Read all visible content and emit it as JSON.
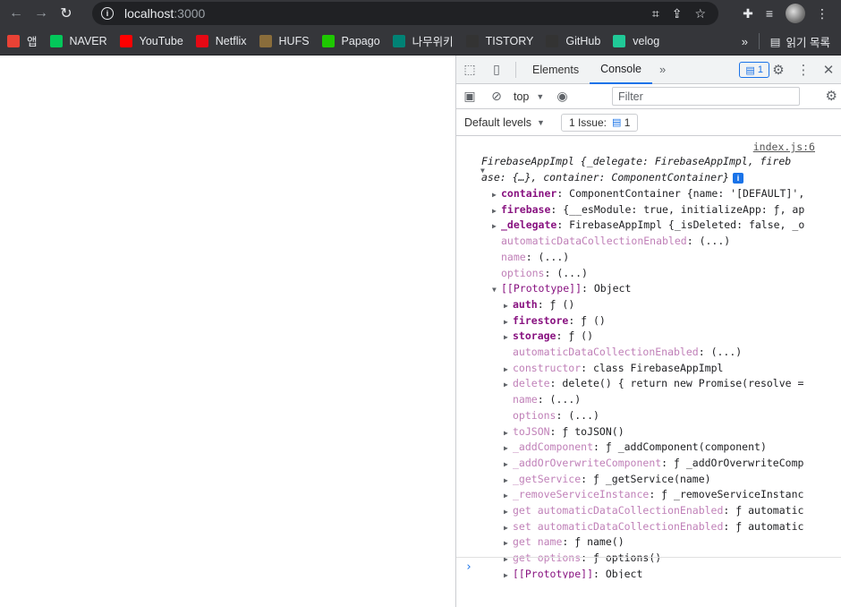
{
  "browser": {
    "url_host": "localhost",
    "url_port": ":3000"
  },
  "bookmarks": [
    {
      "label": "앱",
      "color": "#e94235"
    },
    {
      "label": "NAVER",
      "color": "#03c75a"
    },
    {
      "label": "YouTube",
      "color": "#ff0000"
    },
    {
      "label": "Netflix",
      "color": "#e50914"
    },
    {
      "label": "HUFS",
      "color": "#8a6d3b"
    },
    {
      "label": "Papago",
      "color": "#1ec800"
    },
    {
      "label": "나무위키",
      "color": "#008275"
    },
    {
      "label": "TISTORY",
      "color": "#333333"
    },
    {
      "label": "GitHub",
      "color": "#333333"
    },
    {
      "label": "velog",
      "color": "#20c997"
    }
  ],
  "bookmarks_more": "»",
  "reading_list": "읽기 목록",
  "devtools": {
    "tabs": [
      "Elements",
      "Console"
    ],
    "active_tab": "Console",
    "badge_count": "1",
    "context": "top",
    "filter_placeholder": "Filter",
    "levels": "Default levels",
    "issues": "1 Issue:",
    "issues_count": "1",
    "source_link": "index.js:6",
    "header_line1": "FirebaseAppImpl {_delegate: FirebaseAppImpl, fireb",
    "header_line2": "ase: {…}, container: ComponentContainer}",
    "props": [
      {
        "tri": "▶",
        "key": "container",
        "rest": ": ComponentContainer {name: '[DEFAULT]',",
        "indent": 1,
        "style": "bold"
      },
      {
        "tri": "▶",
        "key": "firebase",
        "rest": ": {__esModule: true, initializeApp: ƒ, ap",
        "indent": 1,
        "style": "bold"
      },
      {
        "tri": "▶",
        "key": "_delegate",
        "rest": ": FirebaseAppImpl {_isDeleted: false, _o",
        "indent": 1,
        "style": "bold"
      },
      {
        "tri": "",
        "key": "automaticDataCollectionEnabled",
        "rest": ": (...)",
        "indent": 1,
        "style": "dim"
      },
      {
        "tri": "",
        "key": "name",
        "rest": ": (...)",
        "indent": 1,
        "style": "dim"
      },
      {
        "tri": "",
        "key": "options",
        "rest": ": (...)",
        "indent": 1,
        "style": "dim"
      },
      {
        "tri": "▼",
        "key": "[[Prototype]]",
        "rest": ": Object",
        "indent": 1,
        "style": "plain"
      },
      {
        "tri": "▶",
        "key": "auth",
        "rest": ": ƒ ()",
        "indent": 2,
        "style": "bold"
      },
      {
        "tri": "▶",
        "key": "firestore",
        "rest": ": ƒ ()",
        "indent": 2,
        "style": "bold"
      },
      {
        "tri": "▶",
        "key": "storage",
        "rest": ": ƒ ()",
        "indent": 2,
        "style": "bold"
      },
      {
        "tri": "",
        "key": "automaticDataCollectionEnabled",
        "rest": ": (...)",
        "indent": 2,
        "style": "dim"
      },
      {
        "tri": "▶",
        "key": "constructor",
        "rest": ": class FirebaseAppImpl",
        "indent": 2,
        "style": "dim"
      },
      {
        "tri": "▶",
        "key": "delete",
        "rest": ": delete() { return new Promise(resolve =",
        "indent": 2,
        "style": "dim"
      },
      {
        "tri": "",
        "key": "name",
        "rest": ": (...)",
        "indent": 2,
        "style": "dim"
      },
      {
        "tri": "",
        "key": "options",
        "rest": ": (...)",
        "indent": 2,
        "style": "dim"
      },
      {
        "tri": "▶",
        "key": "toJSON",
        "rest": ": ƒ toJSON()",
        "indent": 2,
        "style": "dim"
      },
      {
        "tri": "▶",
        "key": "_addComponent",
        "rest": ": ƒ _addComponent(component)",
        "indent": 2,
        "style": "dim"
      },
      {
        "tri": "▶",
        "key": "_addOrOverwriteComponent",
        "rest": ": ƒ _addOrOverwriteComp",
        "indent": 2,
        "style": "dim"
      },
      {
        "tri": "▶",
        "key": "_getService",
        "rest": ": ƒ _getService(name)",
        "indent": 2,
        "style": "dim"
      },
      {
        "tri": "▶",
        "key": "_removeServiceInstance",
        "rest": ": ƒ _removeServiceInstanc",
        "indent": 2,
        "style": "dim"
      },
      {
        "tri": "▶",
        "key": "get automaticDataCollectionEnabled",
        "rest": ": ƒ automatic",
        "indent": 2,
        "style": "dim"
      },
      {
        "tri": "▶",
        "key": "set automaticDataCollectionEnabled",
        "rest": ": ƒ automatic",
        "indent": 2,
        "style": "dim"
      },
      {
        "tri": "▶",
        "key": "get name",
        "rest": ": ƒ name()",
        "indent": 2,
        "style": "dim"
      },
      {
        "tri": "▶",
        "key": "get options",
        "rest": ": ƒ options()",
        "indent": 2,
        "style": "dim"
      },
      {
        "tri": "▶",
        "key": "[[Prototype]]",
        "rest": ": Object",
        "indent": 2,
        "style": "plain"
      }
    ],
    "prompt": "›"
  }
}
